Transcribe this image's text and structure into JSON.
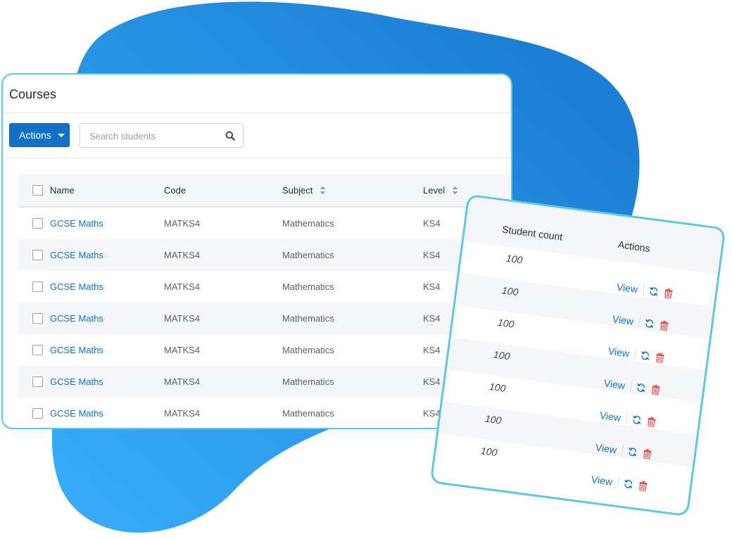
{
  "colors": {
    "accent": "#1271c6",
    "blob": "#2a93e6",
    "card_border": "#5ec6e6",
    "delete": "#e05252"
  },
  "courses_card": {
    "title": "Courses",
    "actions_label": "Actions",
    "search": {
      "placeholder": "Search students",
      "value": ""
    },
    "columns": [
      "Name",
      "Code",
      "Subject",
      "Level"
    ],
    "rows": [
      {
        "name": "GCSE Maths",
        "code": "MATKS4",
        "subject": "Mathematics",
        "level": "KS4"
      },
      {
        "name": "GCSE Maths",
        "code": "MATKS4",
        "subject": "Mathematics",
        "level": "KS4"
      },
      {
        "name": "GCSE Maths",
        "code": "MATKS4",
        "subject": "Mathematics",
        "level": "KS4"
      },
      {
        "name": "GCSE Maths",
        "code": "MATKS4",
        "subject": "Mathematics",
        "level": "KS4"
      },
      {
        "name": "GCSE Maths",
        "code": "MATKS4",
        "subject": "Mathematics",
        "level": "KS4"
      },
      {
        "name": "GCSE Maths",
        "code": "MATKS4",
        "subject": "Mathematics",
        "level": "KS4"
      },
      {
        "name": "GCSE Maths",
        "code": "MATKS4",
        "subject": "Mathematics",
        "level": "KS4"
      }
    ]
  },
  "students_card": {
    "columns": [
      "Student count",
      "Actions"
    ],
    "rows": [
      {
        "count": "100",
        "view": "View"
      },
      {
        "count": "100",
        "view": "View"
      },
      {
        "count": "100",
        "view": "View"
      },
      {
        "count": "100",
        "view": "View"
      },
      {
        "count": "100",
        "view": "View"
      },
      {
        "count": "100",
        "view": "View"
      },
      {
        "count": "100",
        "view": "View"
      }
    ]
  },
  "icons": {
    "actions_caret": "caret-down-icon",
    "search": "search-icon",
    "sort": "sort-icon",
    "refresh": "refresh-icon",
    "delete": "trash-icon"
  }
}
